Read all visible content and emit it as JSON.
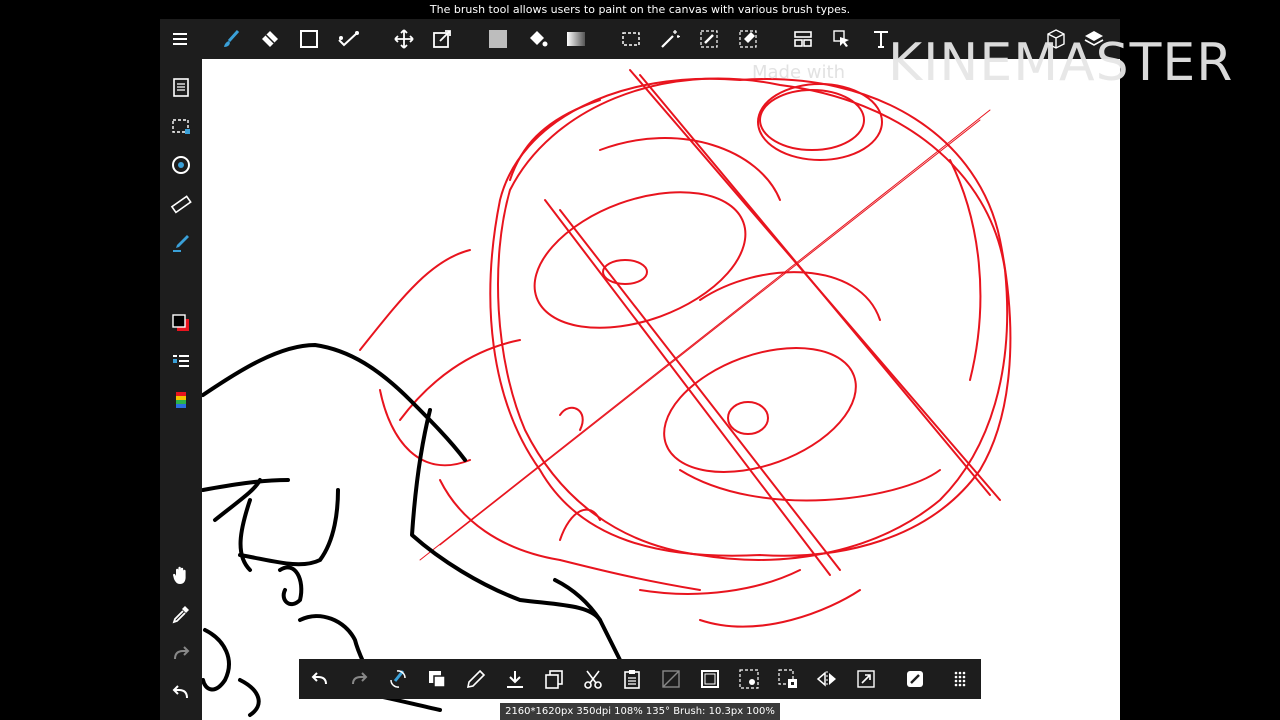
{
  "tooltip": "The brush tool allows users to paint on the canvas with various brush types.",
  "watermark": {
    "brand": "KINEMASTER",
    "prefix": "Made with"
  },
  "status_bar": "2160*1620px 350dpi 108% 135° Brush: 10.3px 100%",
  "colors": {
    "accent": "#3aa0d8",
    "toolbar": "#1d1d1d",
    "sketch_red": "#e8141e",
    "ink": "#000000",
    "primary_color": "#000000",
    "secondary_color": "#e8141e"
  },
  "toolbar_top": [
    "menu-icon",
    "brush-icon",
    "eraser-icon",
    "shape-icon",
    "fill-icon",
    "move-icon",
    "transform-icon",
    "fill-color-icon",
    "bucket-icon",
    "gradient-icon",
    "selection-rect-icon",
    "magic-wand-icon",
    "select-pen-icon",
    "select-eraser-icon",
    "layout-icon",
    "pointer-icon",
    "text-icon",
    "3d-model-icon",
    "layers-icon"
  ],
  "toolbar_left": [
    "pages-icon",
    "selection-icon",
    "rotate-icon",
    "ruler-icon",
    "pen-fill-icon",
    "color-swatch",
    "layer-list-icon",
    "color-palette-icon",
    "hand-icon",
    "eyedropper-icon",
    "redo-icon",
    "undo-icon"
  ],
  "toolbar_bottom": [
    "undo-icon",
    "redo-icon",
    "brush-tweak-icon",
    "color-swap-icon",
    "pen-icon",
    "save-icon",
    "copy-icon",
    "cut-icon",
    "paste-icon",
    "clear-icon",
    "border-icon",
    "select-all-icon",
    "transform-select-icon",
    "flip-icon",
    "resize-icon",
    "edit-icon",
    "more-icon"
  ]
}
